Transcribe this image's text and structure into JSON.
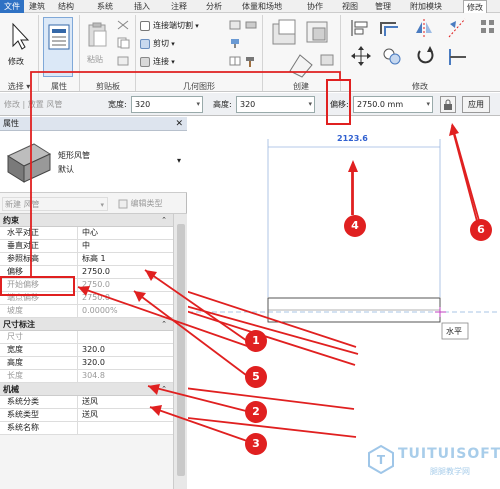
{
  "menu": {
    "file": "文件",
    "items": [
      "建筑",
      "结构",
      "系统",
      "插入",
      "注释",
      "分析",
      "体量和场地",
      "协作",
      "视图",
      "管理",
      "附加模块",
      "修改"
    ]
  },
  "ribbon": {
    "modify_label": "修改",
    "paste_label": "粘贴",
    "clipboard_items": {
      "connect_cut": "连接端切割",
      "cut": "剪切",
      "join": "连接"
    },
    "panels": {
      "select": "选择",
      "properties": "属性",
      "clipboard": "剪贴板",
      "geometry": "几何图形",
      "create": "创建",
      "modify": "修改"
    }
  },
  "options_bar": {
    "context": "修改 | 放置 风管",
    "width_label": "宽度:",
    "width_value": "320",
    "height_label": "高度:",
    "height_value": "320",
    "offset_label": "偏移:",
    "offset_value": "2750.0 mm",
    "apply_label": "应用"
  },
  "properties": {
    "title": "属性",
    "type_name_1": "矩形风管",
    "type_name_2": "默认",
    "instance_selector": "新建 风管",
    "edit_type": "编辑类型",
    "groups": {
      "constraints": "约束",
      "dimensions": "尺寸标注",
      "mechanical": "机械"
    },
    "rows": {
      "h_align": {
        "k": "水平对正",
        "v": "中心"
      },
      "v_align": {
        "k": "垂直对正",
        "v": "中"
      },
      "ref_level": {
        "k": "参照标高",
        "v": "标高 1"
      },
      "offset": {
        "k": "偏移",
        "v": "2750.0"
      },
      "start_offset": {
        "k": "开始偏移",
        "v": "2750.0"
      },
      "end_offset": {
        "k": "端点偏移",
        "v": "2750.0"
      },
      "slope": {
        "k": "坡度",
        "v": "0.0000%"
      },
      "size": {
        "k": "尺寸",
        "v": ""
      },
      "width": {
        "k": "宽度",
        "v": "320.0"
      },
      "height": {
        "k": "高度",
        "v": "320.0"
      },
      "length": {
        "k": "长度",
        "v": "304.8"
      },
      "system_class": {
        "k": "系统分类",
        "v": "送风"
      },
      "system_type": {
        "k": "系统类型",
        "v": "送风"
      },
      "system_name": {
        "k": "系统名称",
        "v": ""
      }
    }
  },
  "canvas": {
    "dimension": "2123.6",
    "tooltip": "水平"
  },
  "callouts": [
    "1",
    "2",
    "3",
    "4",
    "5",
    "6"
  ],
  "watermark": {
    "brand": "TUITUISOFT",
    "sub": "腿腿教学网"
  },
  "colors": {
    "accent": "#2f72c4",
    "callout": "#e02020",
    "dimension": "#3060d0"
  }
}
